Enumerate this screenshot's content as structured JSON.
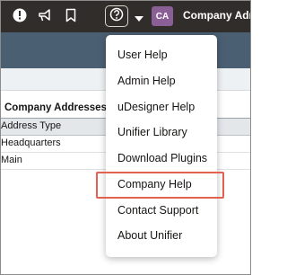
{
  "header": {
    "company_name": "Company Admi",
    "avatar_initials": "CA",
    "colors": {
      "bar": "#312d2a",
      "avatar": "#8a5f95"
    }
  },
  "section": {
    "title": "Company Addresses",
    "column_header": "Address Type",
    "rows": [
      "Headquarters",
      "Main"
    ]
  },
  "help_menu": {
    "items": [
      "User Help",
      "Admin Help",
      "uDesigner Help",
      "Unifier Library",
      "Download Plugins",
      "Company Help",
      "Contact Support",
      "About Unifier"
    ],
    "highlighted_item": "Company Help",
    "highlight_color": "#e2614f"
  }
}
